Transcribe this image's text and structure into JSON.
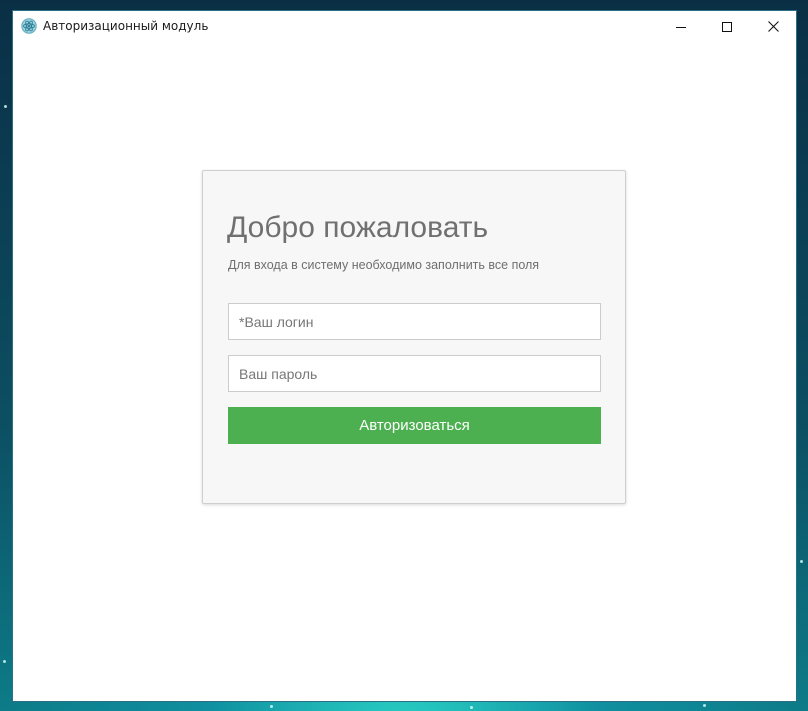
{
  "window": {
    "title": "Авторизационный модуль",
    "icon": "app-logo-icon",
    "controls": {
      "minimize_icon": "minimize-icon",
      "maximize_icon": "maximize-icon",
      "close_icon": "close-icon"
    }
  },
  "login_form": {
    "title": "Добро пожаловать",
    "subtitle": "Для входа в систему необходимо заполнить все поля",
    "login_field": {
      "value": "",
      "placeholder": "*Ваш логин"
    },
    "password_field": {
      "value": "",
      "placeholder": "Ваш пароль"
    },
    "submit_label": "Авторизоваться"
  },
  "colors": {
    "accent": "#4caf50",
    "card_background": "#f7f7f7",
    "title_text": "#707070"
  }
}
